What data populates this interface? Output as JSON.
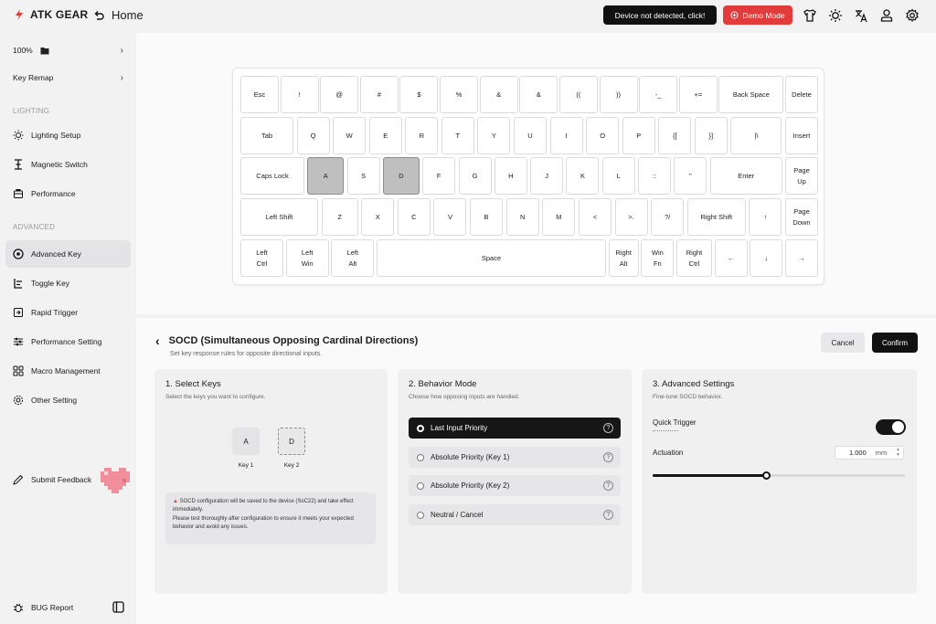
{
  "header": {
    "brand": "ATK GEAR",
    "home_label": "Home",
    "device_button": "Device not detected, click!",
    "demo_button": "Demo Mode",
    "accent_color": "#e23b3b"
  },
  "sidebar": {
    "zoom": "100%",
    "key_remap": "Key Remap",
    "section_lighting": "LIGHTING",
    "lighting_items": [
      "Lighting Setup",
      "Magnetic Switch",
      "Performance"
    ],
    "section_advanced": "ADVANCED",
    "advanced_items": [
      "Advanced Key",
      "Toggle Key",
      "Rapid Trigger",
      "Performance Setting",
      "Macro Management",
      "Other Setting"
    ],
    "feedback": "Submit Feedback",
    "bug_report": "BUG Report"
  },
  "keyboard": {
    "rows": [
      [
        "Esc",
        "!",
        "@",
        "#",
        "$",
        "%",
        "&",
        "&",
        "((",
        "))",
        "-_",
        "+=",
        "Back Space",
        "Delete"
      ],
      [
        "Tab",
        "Q",
        "W",
        "E",
        "R",
        "T",
        "Y",
        "U",
        "I",
        "O",
        "P",
        "{[",
        "}]",
        "|\\",
        "Insert"
      ],
      [
        "Caps Lock",
        "A",
        "S",
        "D",
        "F",
        "G",
        "H",
        "J",
        "K",
        "L",
        "::",
        "\"",
        "Enter",
        "Page Up"
      ],
      [
        "Left Shift",
        "Z",
        "X",
        "C",
        "V",
        "B",
        "N",
        "M",
        "<",
        ">.",
        "?/",
        "Right Shift",
        "↑",
        "Page Down"
      ],
      [
        "Left Ctrl",
        "Left Win",
        "Left Alt",
        "Space",
        "Right Alt",
        "Win Fn",
        "Right Ctrl",
        "←",
        "↓",
        "→"
      ]
    ],
    "selected_keys": [
      "A",
      "D"
    ]
  },
  "socd": {
    "title": "SOCD (Simultaneous Opposing Cardinal Directions)",
    "subtitle": "Set key response rules for opposite directional inputs.",
    "cancel": "Cancel",
    "confirm": "Confirm"
  },
  "select_keys": {
    "title": "1. Select Keys",
    "subtitle": "Select the keys you want to configure.",
    "key1_value": "A",
    "key1_label": "Key 1",
    "key2_value": "D",
    "key2_label": "Key 2",
    "note_line1": "SOCD configuration will be saved to the device (SoC22) and take effect immediately.",
    "note_line2": "Please test thoroughly after configuration to ensure it meets your expected behavior and avoid any issues."
  },
  "behavior": {
    "title": "2. Behavior Mode",
    "subtitle": "Choose how opposing inputs are handled.",
    "options": [
      "Last Input Priority",
      "Absolute Priority (Key 1)",
      "Absolute Priority (Key 2)",
      "Neutral / Cancel"
    ],
    "selected_index": 0
  },
  "advanced": {
    "title": "3. Advanced Settings",
    "subtitle": "Fine-tune SOCD behavior.",
    "quick_trigger_label": "Quick Trigger",
    "quick_trigger_on": true,
    "actuation_label": "Actuation",
    "actuation_value": "1.000",
    "actuation_unit": "mm",
    "slider_fraction": 0.45
  }
}
